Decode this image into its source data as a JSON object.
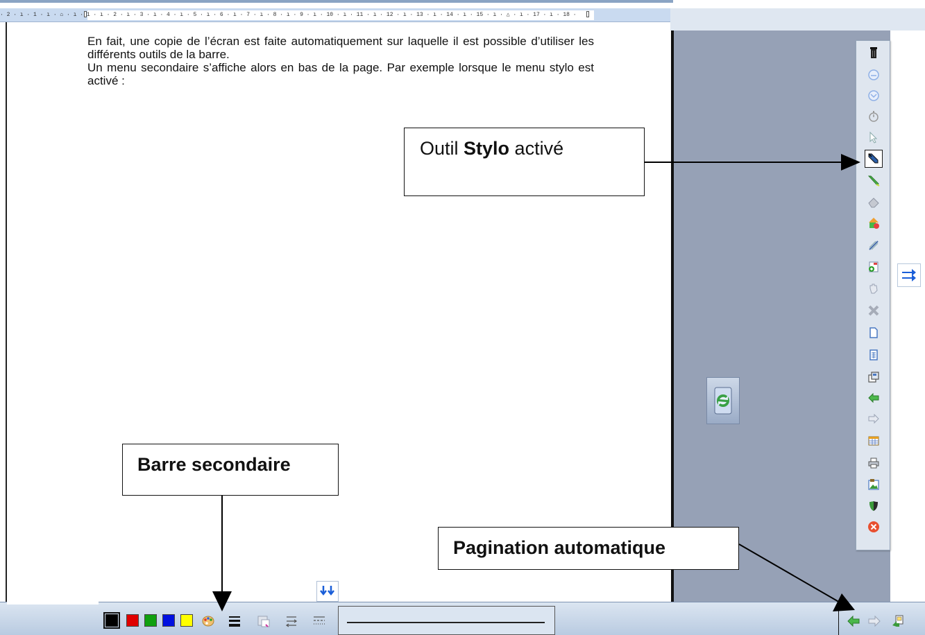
{
  "ruler": {
    "label": "· 2 · ı · 1 · ı · ⌂ · ı · 1 · ı · 2 · ı · 3 · ı · 4 · ı · 5 · ı · 6 · ı · 7 · ı · 8 · ı · 9 · ı · 10 · ı · 11 · ı · 12 · ı · 13 · ı · 14 · ı · 15 · ı · △ · ı · 17 · ı · 18 ·"
  },
  "document": {
    "line1": "En fait, une copie de l’écran est faite automatiquement sur laquelle il est possible d’utiliser les différents outils de la barre.",
    "line2": "Un menu secondaire s’affiche alors en bas de la page. Par exemple lorsque le menu stylo est activé :"
  },
  "callouts": {
    "stylo_prefix": "Outil ",
    "stylo_bold": "Stylo",
    "stylo_suffix": " activé",
    "barre": "Barre secondaire",
    "pagination": "Pagination automatique"
  },
  "toolbar_icons": [
    "trash-icon",
    "circle-up-icon",
    "circle-down-icon",
    "stopwatch-icon",
    "pointer-icon",
    "pen-icon",
    "highlighter-icon",
    "eraser-icon",
    "shapes-icon",
    "line-tool-icon",
    "add-page-icon",
    "hand-icon",
    "delete-icon",
    "blank-page-icon",
    "page-grid-icon",
    "copy-page-icon",
    "back-arrow-icon",
    "forward-arrow-icon",
    "table-icon",
    "print-icon",
    "screenshot-icon",
    "shield-icon",
    "close-icon"
  ],
  "colors": {
    "swatch_black": "#000000",
    "swatch_red": "#e00000",
    "swatch_green": "#10a010",
    "swatch_blue": "#0010e0",
    "swatch_yellow": "#ffff00",
    "panel_gray": "#96a1b6",
    "toolbar_bg": "#dfe6ef"
  }
}
